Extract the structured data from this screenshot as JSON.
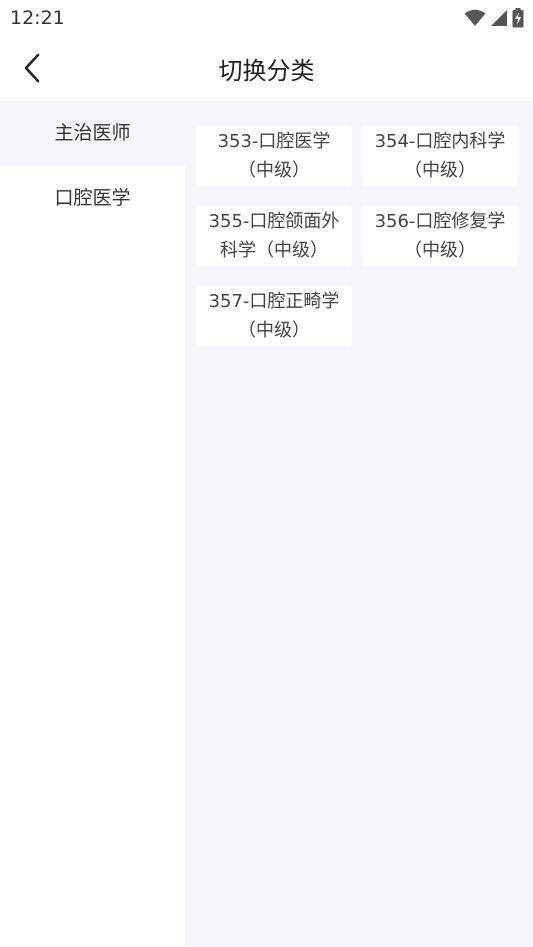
{
  "status_bar": {
    "time": "12:21",
    "icons": [
      "wifi-icon",
      "signal-icon",
      "battery-charging-icon"
    ]
  },
  "header": {
    "title": "切换分类",
    "back_icon": "chevron-left-icon"
  },
  "sidebar": {
    "items": [
      {
        "label": "主治医师",
        "active": true
      },
      {
        "label": "口腔医学",
        "active": false
      }
    ]
  },
  "categories": [
    {
      "label": "353-口腔医学（中级）"
    },
    {
      "label": "354-口腔内科学（中级）"
    },
    {
      "label": "355-口腔颌面外科学（中级）"
    },
    {
      "label": "356-口腔修复学（中级）"
    },
    {
      "label": "357-口腔正畸学（中级）"
    }
  ],
  "colors": {
    "content_bg": "#f4f6fb",
    "card_bg": "#ffffff",
    "text": "#333333"
  }
}
